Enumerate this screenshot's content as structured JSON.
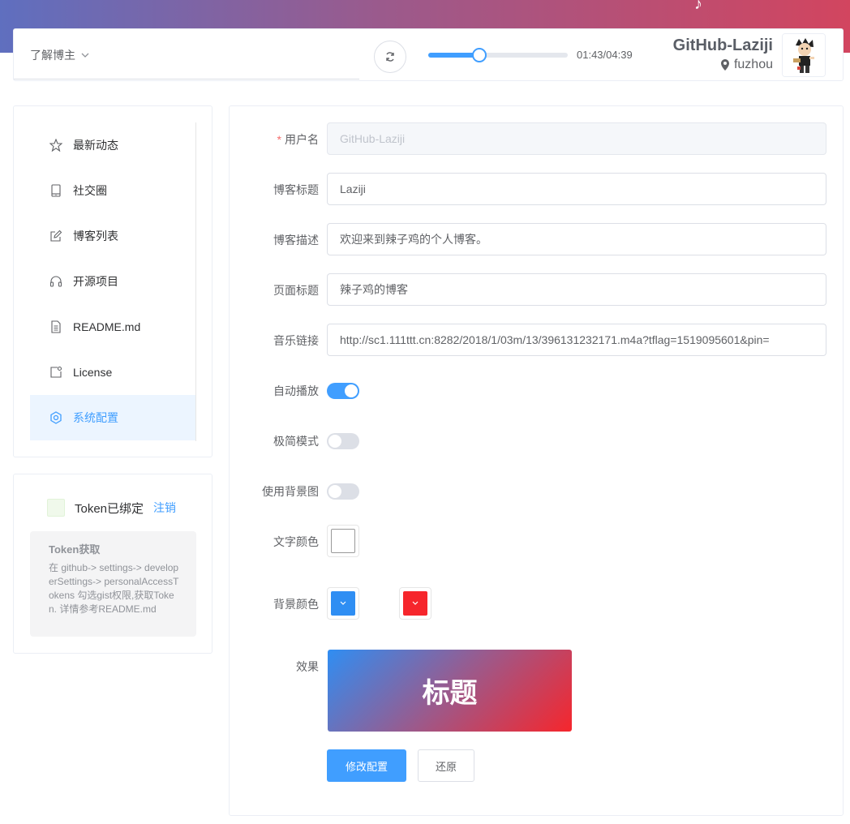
{
  "header": {
    "about_label": "了解博主",
    "time": "01:43/04:39",
    "music_progress": 0.369,
    "user_name": "GitHub-Laziji",
    "location": "fuzhou"
  },
  "sidebar": {
    "items": [
      {
        "label": "最新动态",
        "icon": "star-icon"
      },
      {
        "label": "社交圈",
        "icon": "tablet-icon"
      },
      {
        "label": "博客列表",
        "icon": "edit-icon"
      },
      {
        "label": "开源项目",
        "icon": "headset-icon"
      },
      {
        "label": "README.md",
        "icon": "document-icon"
      },
      {
        "label": "License",
        "icon": "license-icon"
      },
      {
        "label": "系统配置",
        "icon": "setting-icon",
        "active": true
      }
    ]
  },
  "token": {
    "status": "Token已绑定",
    "logout_label": "注销",
    "help_title": "Token获取",
    "help_text": "在 github-> settings-> developerSettings-> personalAccessTokens 勾选gist权限,获取Token. 详情参考README.md"
  },
  "form": {
    "username_label": "用户名",
    "username_value": "GitHub-Laziji",
    "blog_title_label": "博客标题",
    "blog_title_value": "Laziji",
    "blog_desc_label": "博客描述",
    "blog_desc_value": "欢迎来到辣子鸡的个人博客。",
    "page_title_label": "页面标题",
    "page_title_value": "辣子鸡的博客",
    "music_label": "音乐链接",
    "music_value": "http://sc1.111ttt.cn:8282/2018/1/03m/13/396131232171.m4a?tflag=1519095601&pin=",
    "autoplay_label": "自动播放",
    "autoplay_on": true,
    "minimal_label": "极简模式",
    "minimal_on": false,
    "bgimage_label": "使用背景图",
    "bgimage_on": false,
    "text_color_label": "文字颜色",
    "text_color": "#ffffff",
    "bg_color_label": "背景颜色",
    "bg_color_start": "#2f8ef3",
    "bg_color_end": "#f6262c",
    "effect_label": "效果",
    "preview_title": "标题",
    "submit_label": "修改配置",
    "reset_label": "还原"
  },
  "colors": {
    "accent": "#409eff",
    "banner_start": "#5f6fbf",
    "banner_end": "#d2455f"
  }
}
